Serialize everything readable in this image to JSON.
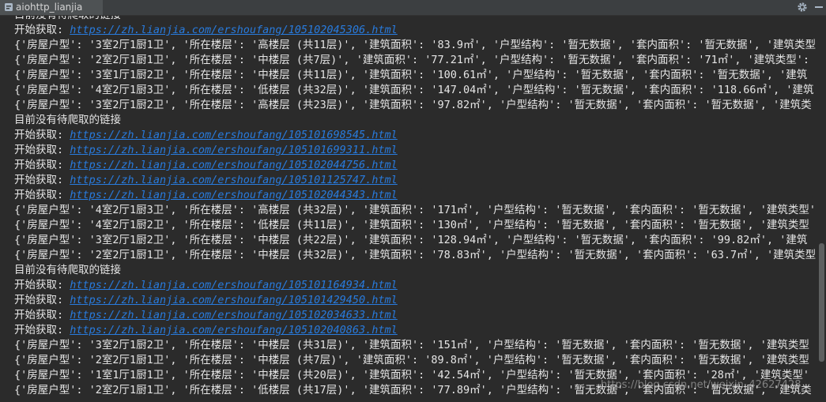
{
  "tab": {
    "title": "aiohttp_lianjia",
    "icon": "python-console-icon"
  },
  "toolbar": {
    "settings_icon": "gear-icon",
    "hide_icon": "minimize-icon"
  },
  "console": {
    "lines": [
      {
        "kind": "text",
        "text": "目前没有待爬取的链接"
      },
      {
        "kind": "fetch",
        "prefix": "开始获取: ",
        "url": "https://zh.lianjia.com/ershoufang/105102045306.html"
      },
      {
        "kind": "text",
        "text": "{'房屋户型': '3室2厅1厨1卫', '所在楼层': '高楼层 (共11层)', '建筑面积': '83.9㎡', '户型结构': '暂无数据', '套内面积': '暂无数据', '建筑类型': '"
      },
      {
        "kind": "text",
        "text": "{'房屋户型': '2室2厅1厨1卫', '所在楼层': '中楼层 (共7层)', '建筑面积': '77.21㎡', '户型结构': '暂无数据', '套内面积': '71㎡', '建筑类型': '"
      },
      {
        "kind": "text",
        "text": "{'房屋户型': '3室1厅1厨2卫', '所在楼层': '中楼层 (共11层)', '建筑面积': '100.61㎡', '户型结构': '暂无数据', '套内面积': '暂无数据', '建筑"
      },
      {
        "kind": "text",
        "text": "{'房屋户型': '4室2厅1厨3卫', '所在楼层': '低楼层 (共32层)', '建筑面积': '147.04㎡', '户型结构': '暂无数据', '套内面积': '118.66㎡', '建筑"
      },
      {
        "kind": "text",
        "text": "{'房屋户型': '3室2厅1厨2卫', '所在楼层': '高楼层 (共23层)', '建筑面积': '97.82㎡', '户型结构': '暂无数据', '套内面积': '暂无数据', '建筑类"
      },
      {
        "kind": "text",
        "text": "目前没有待爬取的链接"
      },
      {
        "kind": "fetch",
        "prefix": "开始获取: ",
        "url": "https://zh.lianjia.com/ershoufang/105101698545.html"
      },
      {
        "kind": "fetch",
        "prefix": "开始获取: ",
        "url": "https://zh.lianjia.com/ershoufang/105101699311.html"
      },
      {
        "kind": "fetch",
        "prefix": "开始获取: ",
        "url": "https://zh.lianjia.com/ershoufang/105102044756.html"
      },
      {
        "kind": "fetch",
        "prefix": "开始获取: ",
        "url": "https://zh.lianjia.com/ershoufang/105101125747.html"
      },
      {
        "kind": "fetch",
        "prefix": "开始获取: ",
        "url": "https://zh.lianjia.com/ershoufang/105102044343.html"
      },
      {
        "kind": "text",
        "text": "{'房屋户型': '4室2厅1厨3卫', '所在楼层': '高楼层 (共32层)', '建筑面积': '171㎡', '户型结构': '暂无数据', '套内面积': '暂无数据', '建筑类型': '"
      },
      {
        "kind": "text",
        "text": "{'房屋户型': '4室2厅1厨2卫', '所在楼层': '低楼层 (共11层)', '建筑面积': '130㎡', '户型结构': '暂无数据', '套内面积': '暂无数据', '建筑类型"
      },
      {
        "kind": "text",
        "text": "{'房屋户型': '3室2厅1厨2卫', '所在楼层': '中楼层 (共22层)', '建筑面积': '128.94㎡', '户型结构': '暂无数据', '套内面积': '99.82㎡', '建筑"
      },
      {
        "kind": "text",
        "text": "{'房屋户型': '2室2厅1厨1卫', '所在楼层': '中楼层 (共32层)', '建筑面积': '78.83㎡', '户型结构': '暂无数据', '套内面积': '63.7㎡', '建筑类型"
      },
      {
        "kind": "text",
        "text": "目前没有待爬取的链接"
      },
      {
        "kind": "fetch",
        "prefix": "开始获取: ",
        "url": "https://zh.lianjia.com/ershoufang/105101164934.html"
      },
      {
        "kind": "fetch",
        "prefix": "开始获取: ",
        "url": "https://zh.lianjia.com/ershoufang/105101429450.html"
      },
      {
        "kind": "fetch",
        "prefix": "开始获取: ",
        "url": "https://zh.lianjia.com/ershoufang/105102034633.html"
      },
      {
        "kind": "fetch",
        "prefix": "开始获取: ",
        "url": "https://zh.lianjia.com/ershoufang/105102040863.html"
      },
      {
        "kind": "text",
        "text": "{'房屋户型': '3室2厅1厨2卫', '所在楼层': '中楼层 (共31层)', '建筑面积': '151㎡', '户型结构': '暂无数据', '套内面积': '暂无数据', '建筑类型"
      },
      {
        "kind": "text",
        "text": "{'房屋户型': '2室2厅1厨1卫', '所在楼层': '中楼层 (共7层)', '建筑面积': '89.8㎡', '户型结构': '暂无数据', '套内面积': '暂无数据', '建筑类型"
      },
      {
        "kind": "text",
        "text": "{'房屋户型': '1室1厅1厨1卫', '所在楼层': '中楼层 (共20层)', '建筑面积': '42.54㎡', '户型结构': '暂无数据', '套内面积': '28㎡', '建筑类型'"
      },
      {
        "kind": "text",
        "text": "{'房屋户型': '2室2厅1厨1卫', '所在楼层': '低楼层 (共17层)', '建筑面积': '77.89㎡', '户型结构': '暂无数据', '套内面积': '暂无数据', '建筑类"
      }
    ]
  },
  "watermark": "https://blog.csdn.net/weixin_42627428",
  "colors": {
    "background": "#2b2b2b",
    "text": "#e6e6e6",
    "link": "#287bde",
    "tabbar": "#3c3f41"
  }
}
